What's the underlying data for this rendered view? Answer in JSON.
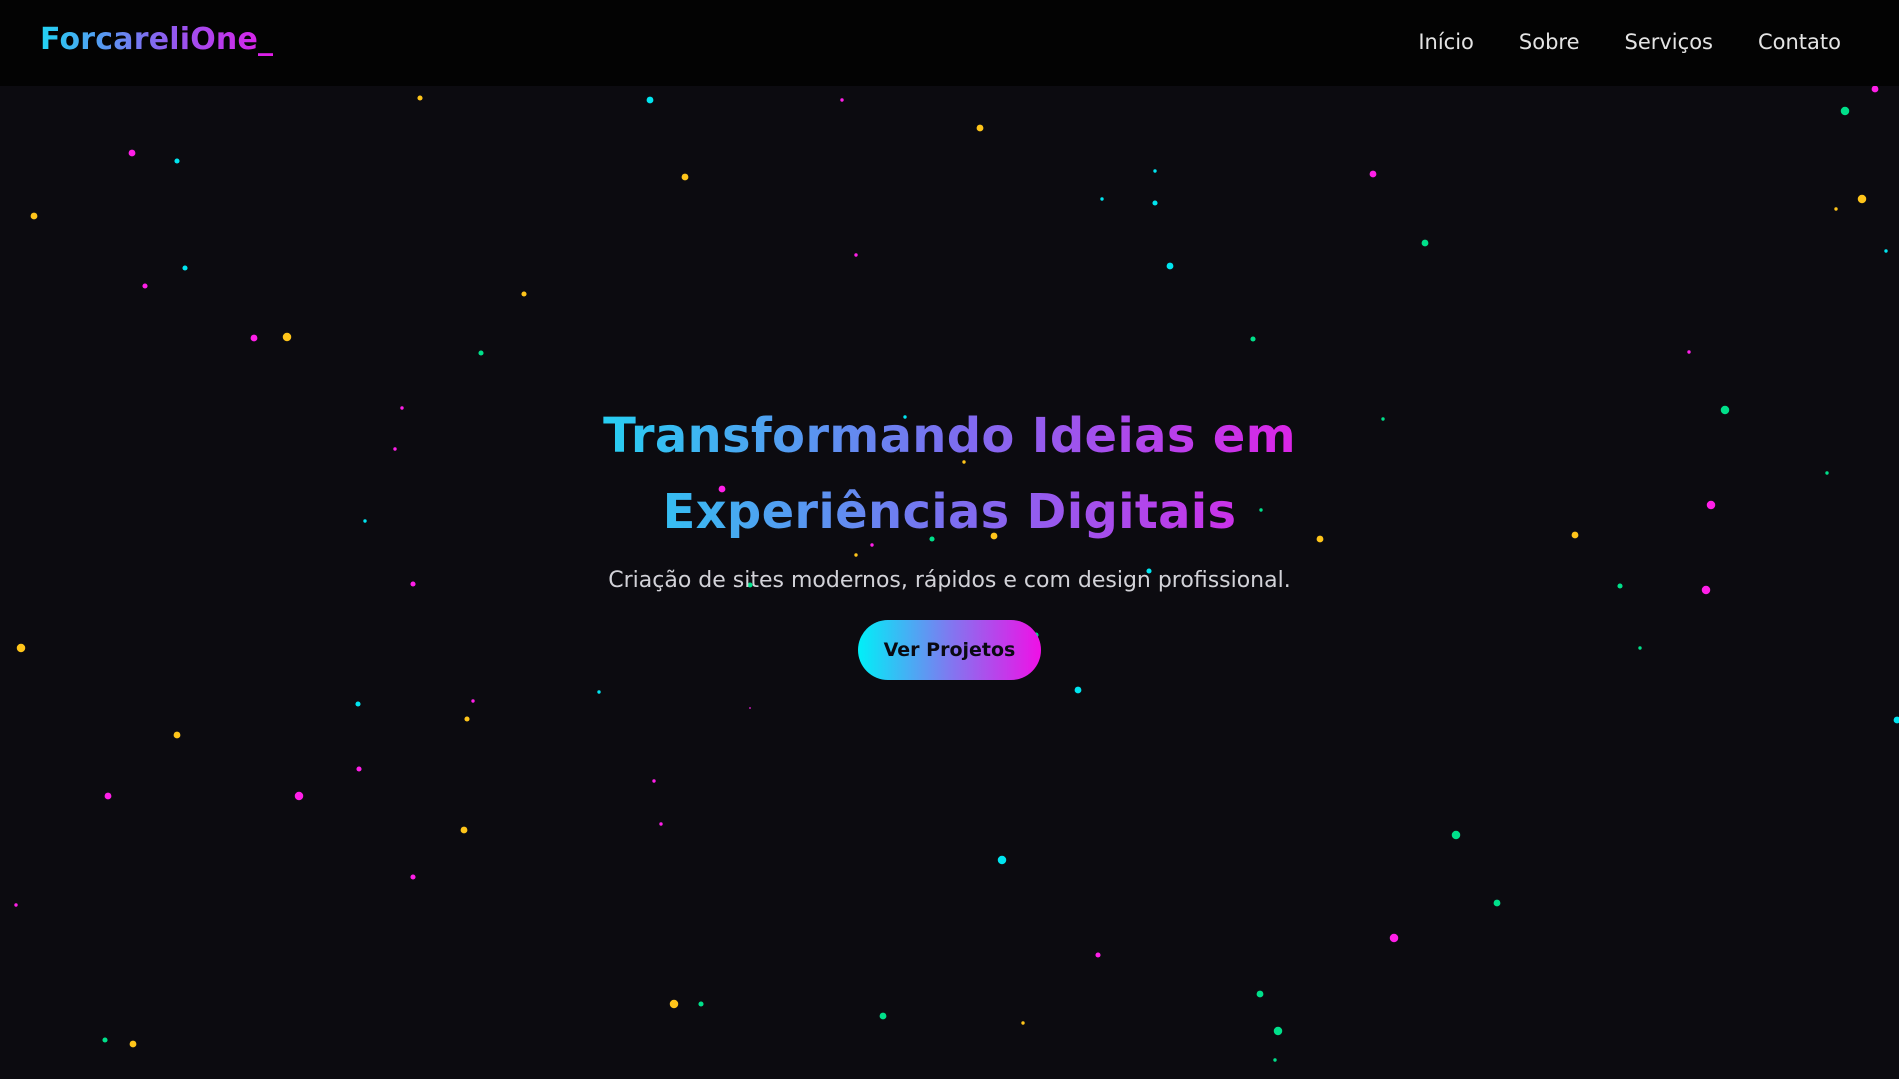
{
  "navbar": {
    "logo": "ForcareliOne_",
    "links": [
      {
        "label": "Início"
      },
      {
        "label": "Sobre"
      },
      {
        "label": "Serviços"
      },
      {
        "label": "Contato"
      }
    ]
  },
  "hero": {
    "title": "Transformando Ideias em Experiências Digitais",
    "subtitle": "Criação de sites modernos, rápidos e com design profissional.",
    "cta_label": "Ver Projetos"
  },
  "theme": {
    "background": "#0c0b10",
    "navbar_background": "#030303",
    "particle_colors": [
      "#00e5f0",
      "#ff1fe8",
      "#ffc51a",
      "#00e08a"
    ]
  }
}
